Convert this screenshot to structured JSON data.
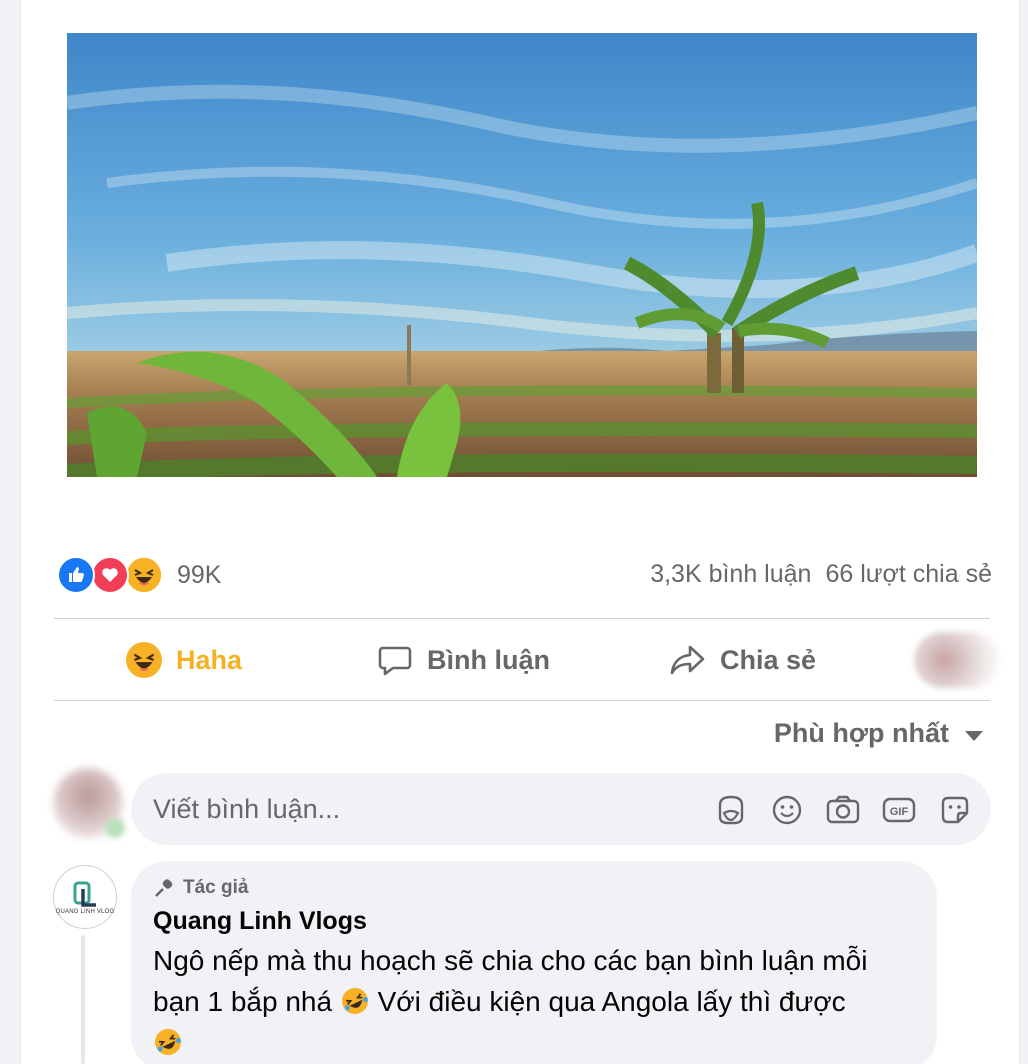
{
  "post": {
    "reactions": {
      "icons": [
        "like-icon",
        "love-icon",
        "haha-icon"
      ],
      "count": "99K"
    },
    "comments_count": "3,3K bình luận",
    "shares_count": "66 lượt chia sẻ"
  },
  "actions": {
    "reaction_label": "Haha",
    "comment_label": "Bình luận",
    "share_label": "Chia sẻ"
  },
  "sort": {
    "label": "Phù hợp nhất"
  },
  "composer": {
    "placeholder": "Viết bình luận...",
    "icons": [
      "sticker-icon",
      "emoji-icon",
      "camera-icon",
      "gif-icon",
      "sticker-face-icon"
    ]
  },
  "comment": {
    "badge": "Tác giả",
    "author": "Quang Linh Vlogs",
    "text_part1": "Ngô nếp mà thu hoạch sẽ chia cho các bạn bình luận mỗi bạn 1 bắp nhá",
    "text_part2": "Với điều kiện qua Angola lấy thì được",
    "avatar_caption": "QUANG LINH VLOG"
  },
  "colors": {
    "like": "#1877f2",
    "love": "#f33e58",
    "haha": "#f7b125",
    "muted": "#65676b",
    "bubble": "#f0f2f5"
  }
}
